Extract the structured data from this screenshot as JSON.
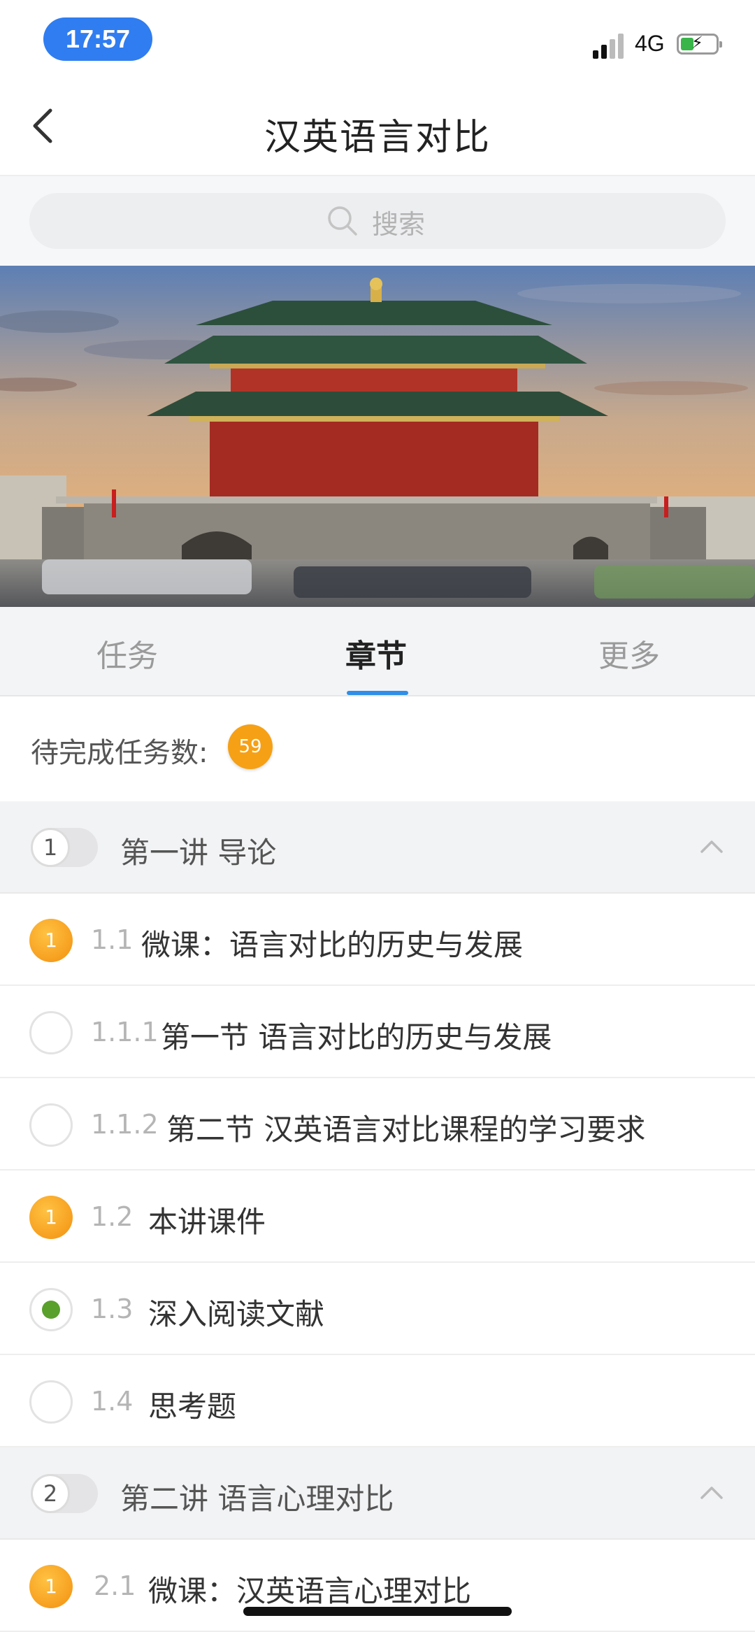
{
  "status_bar": {
    "time": "17:57",
    "network": "4G"
  },
  "nav": {
    "title": "汉英语言对比"
  },
  "search": {
    "placeholder": "搜索"
  },
  "tabs": [
    {
      "label": "任务",
      "active": false
    },
    {
      "label": "章节",
      "active": true
    },
    {
      "label": "更多",
      "active": false
    }
  ],
  "pending": {
    "label": "待完成任务数:",
    "count": "59"
  },
  "chapters": [
    {
      "number": "1",
      "title": "第一讲  导论",
      "items": [
        {
          "num": "1.1",
          "label": "微课：语言对比的历史与发展",
          "status": "1"
        },
        {
          "num": "1.1.1",
          "label": "第一节 语言对比的历史与发展",
          "status": ""
        },
        {
          "num": "1.1.2",
          "label": "第二节  汉英语言对比课程的学习要求",
          "status": ""
        },
        {
          "num": "1.2",
          "label": "本讲课件",
          "status": "1"
        },
        {
          "num": "1.3",
          "label": "深入阅读文献",
          "status": "done"
        },
        {
          "num": "1.4",
          "label": "思考题",
          "status": ""
        }
      ]
    },
    {
      "number": "2",
      "title": "第二讲 语言心理对比",
      "items": [
        {
          "num": "2.1",
          "label": "微课：汉英语言心理对比",
          "status": "1"
        }
      ]
    }
  ],
  "colors": {
    "accent": "#2f8ee8",
    "badge": "#f6a015",
    "done": "#5aa02c",
    "time_pill": "#2f7df0"
  }
}
